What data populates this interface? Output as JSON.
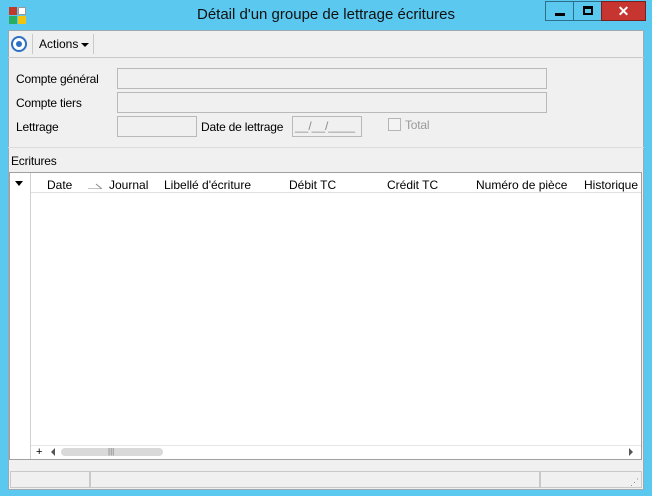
{
  "window": {
    "title": "Détail d'un groupe de lettrage écritures",
    "close_glyph": "✕",
    "accent_color": "#5ac8ef"
  },
  "toolbar": {
    "actions_label": "Actions"
  },
  "form": {
    "compte_general_label": "Compte général",
    "compte_tiers_label": "Compte tiers",
    "lettrage_label": "Lettrage",
    "date_lettrage_label": "Date de lettrage",
    "date_lettrage_value": "__/__/____",
    "total_label": "Total",
    "total_checked": false
  },
  "ecritures": {
    "section_label": "Ecritures",
    "columns": [
      "Date",
      "Journal",
      "Libellé d'écriture",
      "Débit TC",
      "Crédit TC",
      "Numéro de pièce",
      "Historique"
    ],
    "rows": [],
    "add_row_glyph": "+",
    "scroll_grip_glyph": "|||"
  },
  "statusbar": {
    "resize_grip_glyph": "⋰"
  }
}
